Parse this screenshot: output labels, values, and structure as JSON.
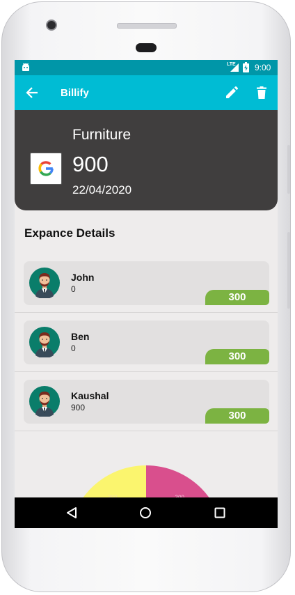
{
  "status_bar": {
    "time": "9:00",
    "network": "LTE"
  },
  "app_bar": {
    "title": "Billify",
    "back_icon": "arrow-left-icon",
    "edit_icon": "pencil-icon",
    "delete_icon": "trash-icon"
  },
  "expense": {
    "name": "Furniture",
    "amount": "900",
    "date": "22/04/2020",
    "logo_letter": "G"
  },
  "section": {
    "title": "Expance Details"
  },
  "members": [
    {
      "name": "John",
      "paid": "0",
      "share": "300"
    },
    {
      "name": "Ben",
      "paid": "0",
      "share": "300"
    },
    {
      "name": "Kaushal",
      "paid": "900",
      "share": "300"
    }
  ],
  "chart_data": {
    "type": "pie",
    "labels": [
      "300",
      "300"
    ],
    "colors": [
      "#fbf56e",
      "#d94f8d"
    ]
  },
  "colors": {
    "status_bar": "#0096a8",
    "app_bar": "#00bcd4",
    "hero": "#403e3e",
    "badge": "#7cb342"
  }
}
